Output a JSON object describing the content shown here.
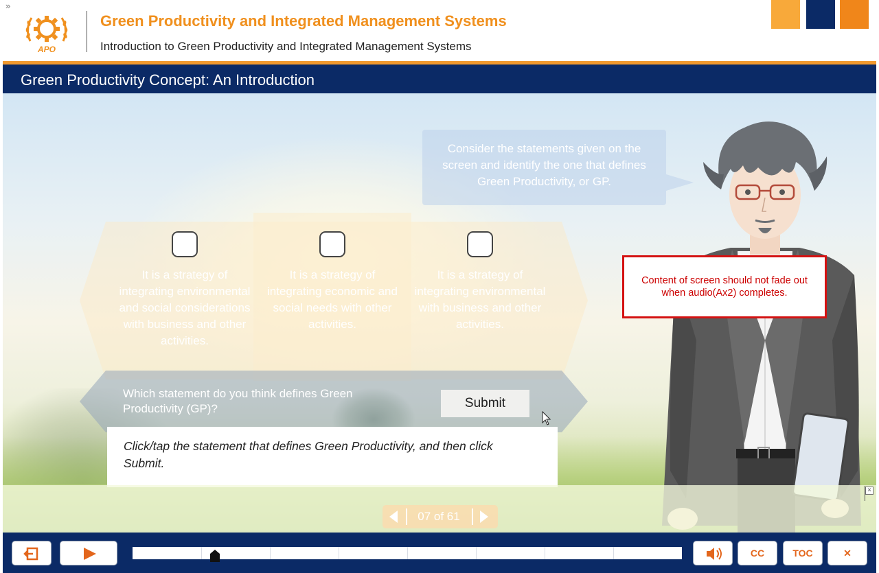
{
  "header": {
    "expand_glyph": "»",
    "course_title": "Green Productivity and Integrated Management Systems",
    "course_subtitle": "Introduction to Green Productivity and Integrated Management Systems",
    "logo_text": "APO",
    "brand_colors": [
      "#f8a93a",
      "#0b2a66",
      "#f0861a"
    ]
  },
  "slide": {
    "title": "Green Productivity Concept: An Introduction",
    "speech": "Consider the statements given on the screen and identify the one that defines Green Productivity, or GP.",
    "options": [
      {
        "text": "It is a strategy of integrating environmental and social considerations with business and other activities.",
        "checked": false
      },
      {
        "text": "It is a strategy of integrating economic and social needs with other activities.",
        "checked": false
      },
      {
        "text": "It is a strategy of integrating environmental with business and other activities.",
        "checked": false
      }
    ],
    "question": "Which statement do you think defines Green Productivity (GP)?",
    "submit_label": "Submit",
    "instruction": "Click/tap the statement that defines Green Productivity, and then click Submit.",
    "review_note": "Content of screen should not fade out when audio(Ax2) completes."
  },
  "pager": {
    "label": "07 of 61",
    "prev_icon": "triangle-left-icon",
    "next_icon": "triangle-right-icon"
  },
  "band": {
    "close_glyph": "×"
  },
  "player": {
    "exit_icon": "exit-icon",
    "play_icon": "play-icon",
    "audio_icon": "speaker-icon",
    "cc_label": "CC",
    "toc_label": "TOC",
    "close_glyph": "✕",
    "progress": 0.15,
    "accent": "#e3661c",
    "bar_color": "#0b2a66"
  }
}
